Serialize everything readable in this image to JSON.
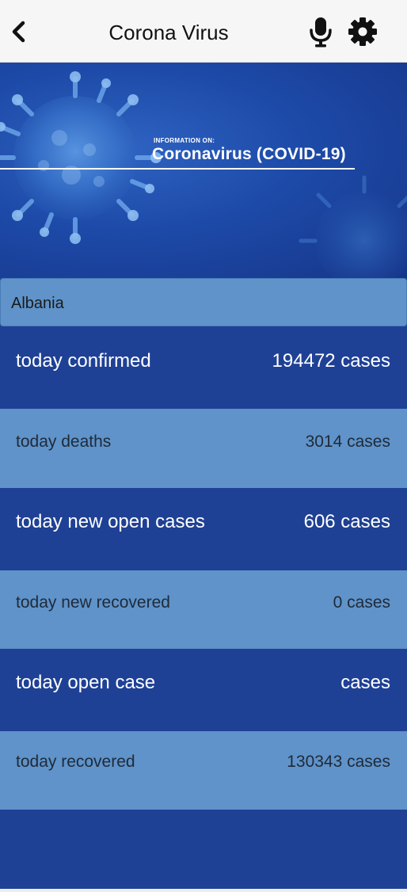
{
  "header": {
    "title": "Corona Virus",
    "back_icon": "chevron-left-icon",
    "mic_icon": "microphone-icon",
    "settings_icon": "gear-icon"
  },
  "banner": {
    "kicker": "INFORMATION ON:",
    "heading": "Coronavirus (COVID-19)"
  },
  "country": {
    "selected": "Albania"
  },
  "stats": [
    {
      "label": "today confirmed",
      "value": "194472 cases"
    },
    {
      "label": "today deaths",
      "value": "3014 cases"
    },
    {
      "label": "today new open cases",
      "value": "606 cases"
    },
    {
      "label": "today new recovered",
      "value": "0 cases"
    },
    {
      "label": "today open case",
      "value": "cases"
    },
    {
      "label": "today recovered",
      "value": "130343 cases"
    }
  ],
  "colors": {
    "dark_row": "#1f4195",
    "light_row": "#5f93c9",
    "header_bg": "#f6f6f6"
  }
}
